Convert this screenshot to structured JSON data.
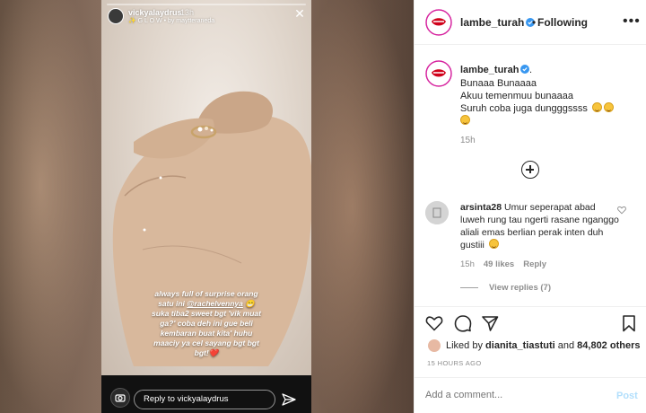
{
  "story": {
    "username": "vickyalaydrus",
    "time": "13h",
    "filter_credit": "✨ G L O W • by maytteraneda",
    "caption": {
      "line1": "always full of surprise orang",
      "line2_prefix": "satu ini ",
      "mention": "@rachelvennya",
      "line2_suffix": " 😁",
      "line3": "suka tiba2 sweet bgt 'vik muat",
      "line4": "ga?' coba deh ini gue beli",
      "line5": "kembaran buat kita' huhu",
      "line6": "maaciy ya cel sayang bgt bgt",
      "line7": "bgt!❤️"
    },
    "reply_placeholder": "Reply to vickyalaydrus"
  },
  "header": {
    "username": "lambe_turah",
    "separator": "•",
    "follow_status": "Following",
    "more": "•••"
  },
  "caption": {
    "username": "lambe_turah",
    "suffix": ".",
    "lines": [
      "Bunaaa Bunaaaa",
      "Akuu temenmuu bunaaaa",
      "Suruh coba juga dungggssss"
    ],
    "time": "15h"
  },
  "comment": {
    "username": "arsinta28",
    "text": "Umur seperapat abad luweh rung tau ngerti rasane nganggo aliali emas berlian perak inten duh gustiii",
    "time": "15h",
    "likes": "49 likes",
    "reply": "Reply",
    "view_replies": "View replies (7)"
  },
  "likes": {
    "prefix": "Liked by",
    "user": "dianita_tiastuti",
    "and": "and",
    "count": "84,802 others"
  },
  "posted_ago": "15 HOURS AGO",
  "add_comment": {
    "placeholder": "Add a comment...",
    "post_label": "Post"
  },
  "colors": {
    "verified": "#3897f0",
    "post_button_disabled": "#b2dffc",
    "meta_gray": "#8e8e8e"
  }
}
